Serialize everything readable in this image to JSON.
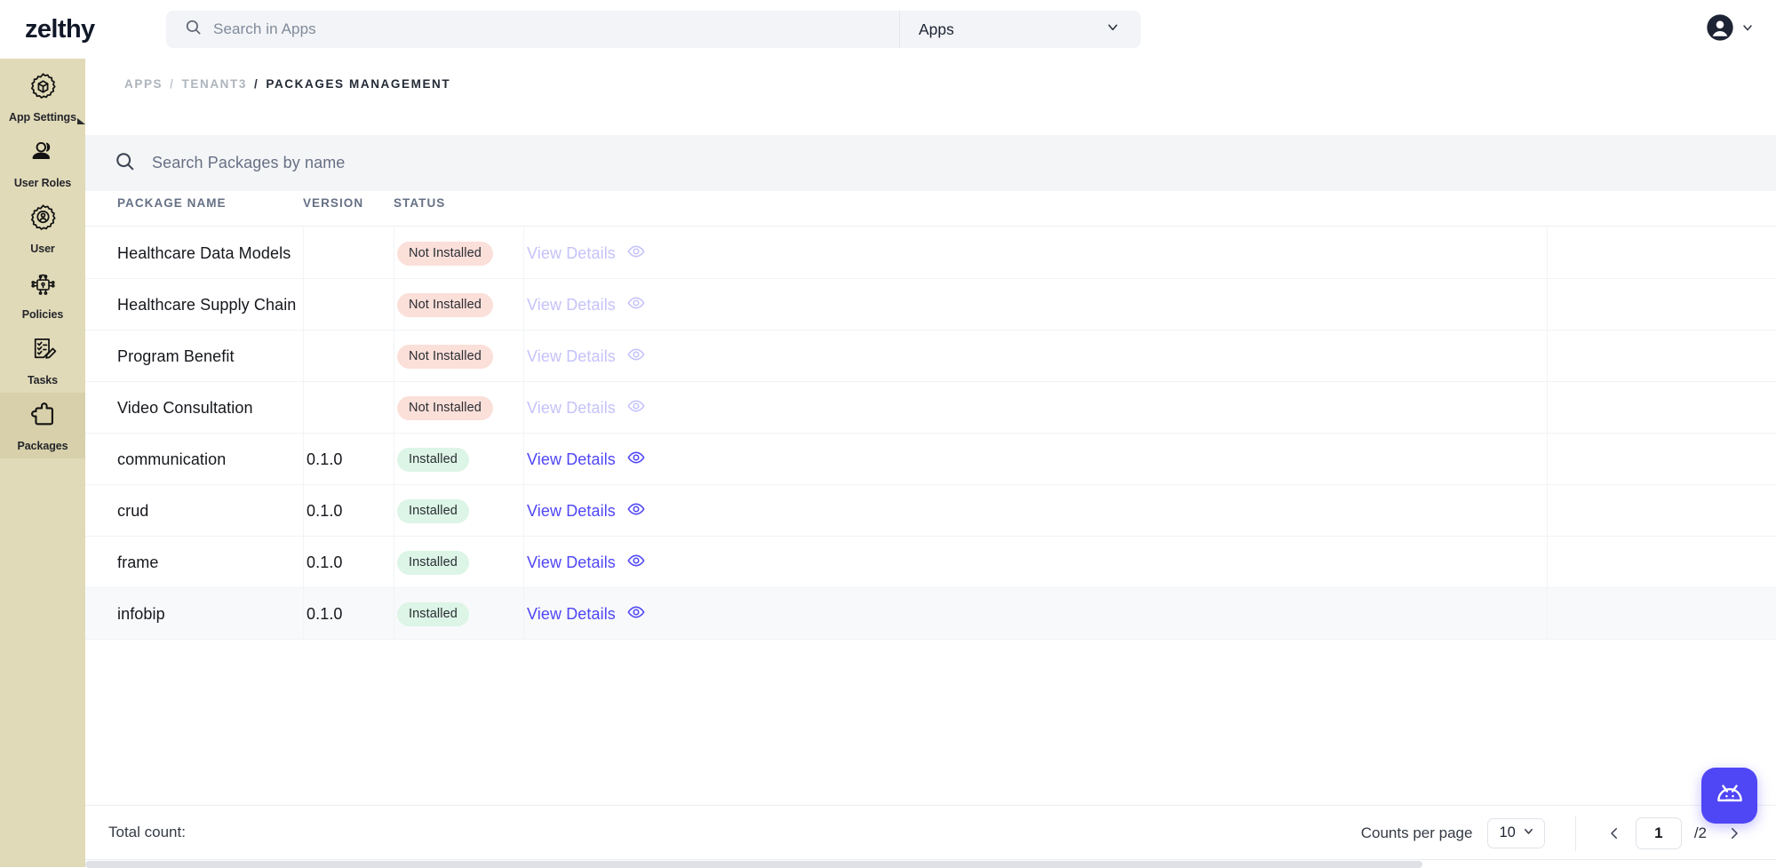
{
  "brand": "zelthy",
  "topbar": {
    "search_placeholder": "Search in Apps",
    "search_icon": "search-icon",
    "scope_value": "Apps",
    "scope_caret_icon": "chevron-down-icon",
    "avatar_icon": "user-avatar-icon",
    "avatar_caret_icon": "chevron-down-icon"
  },
  "sidebar": {
    "items": [
      {
        "label": "App Settings",
        "icon": "gear-box-icon",
        "active": false,
        "caret": true
      },
      {
        "label": "User Roles",
        "icon": "user-roles-icon",
        "active": false,
        "caret": false
      },
      {
        "label": "User",
        "icon": "gear-user-icon",
        "active": false,
        "caret": false
      },
      {
        "label": "Policies",
        "icon": "policies-lock-icon",
        "active": false,
        "caret": false
      },
      {
        "label": "Tasks",
        "icon": "tasks-checklist-icon",
        "active": false,
        "caret": false
      },
      {
        "label": "Packages",
        "icon": "puzzle-piece-icon",
        "active": true,
        "caret": false
      }
    ]
  },
  "breadcrumb": {
    "apps": "APPS",
    "sep1": "/",
    "tenant": "TENANT3",
    "sep2": "/",
    "current": "PACKAGES MANAGEMENT"
  },
  "package_search": {
    "icon": "search-icon",
    "placeholder": "Search Packages by name",
    "value": ""
  },
  "table": {
    "columns": {
      "name": "PACKAGE NAME",
      "version": "VERSION",
      "status": "STATUS"
    },
    "action_label": "View Details",
    "action_icon": "eye-icon",
    "rows": [
      {
        "name": "Healthcare Data Models",
        "version": "",
        "status": "Not Installed",
        "installed": false,
        "hovered": false
      },
      {
        "name": "Healthcare Supply Chain",
        "version": "",
        "status": "Not Installed",
        "installed": false,
        "hovered": false
      },
      {
        "name": "Program Benefit",
        "version": "",
        "status": "Not Installed",
        "installed": false,
        "hovered": false
      },
      {
        "name": "Video Consultation",
        "version": "",
        "status": "Not Installed",
        "installed": false,
        "hovered": false
      },
      {
        "name": "communication",
        "version": "0.1.0",
        "status": "Installed",
        "installed": true,
        "hovered": false
      },
      {
        "name": "crud",
        "version": "0.1.0",
        "status": "Installed",
        "installed": true,
        "hovered": false
      },
      {
        "name": "frame",
        "version": "0.1.0",
        "status": "Installed",
        "installed": true,
        "hovered": false
      },
      {
        "name": "infobip",
        "version": "0.1.0",
        "status": "Installed",
        "installed": true,
        "hovered": true
      }
    ]
  },
  "footer": {
    "total_count_label": "Total count:",
    "total_count_value": "",
    "counts_per_page_label": "Counts per page",
    "counts_per_page_value": "10",
    "counts_per_page_caret": "chevron-down-icon",
    "prev_icon": "chevron-left-icon",
    "next_icon": "chevron-right-icon",
    "current_page": "1",
    "total_pages": "/2"
  },
  "fab": {
    "icon": "robot-assistant-icon",
    "color": "#4F46F5"
  },
  "colors": {
    "sidebar_bg": "#E0DAB8",
    "sidebar_active": "#D7D0AA",
    "accent": "#4F46F5",
    "accent_muted": "#C5C2FA",
    "badge_not_installed_bg": "#FBDFD9",
    "badge_installed_bg": "#DCF5E6",
    "search_bg": "#F4F5F7",
    "topbar_input_bg": "#F2F4F7"
  }
}
